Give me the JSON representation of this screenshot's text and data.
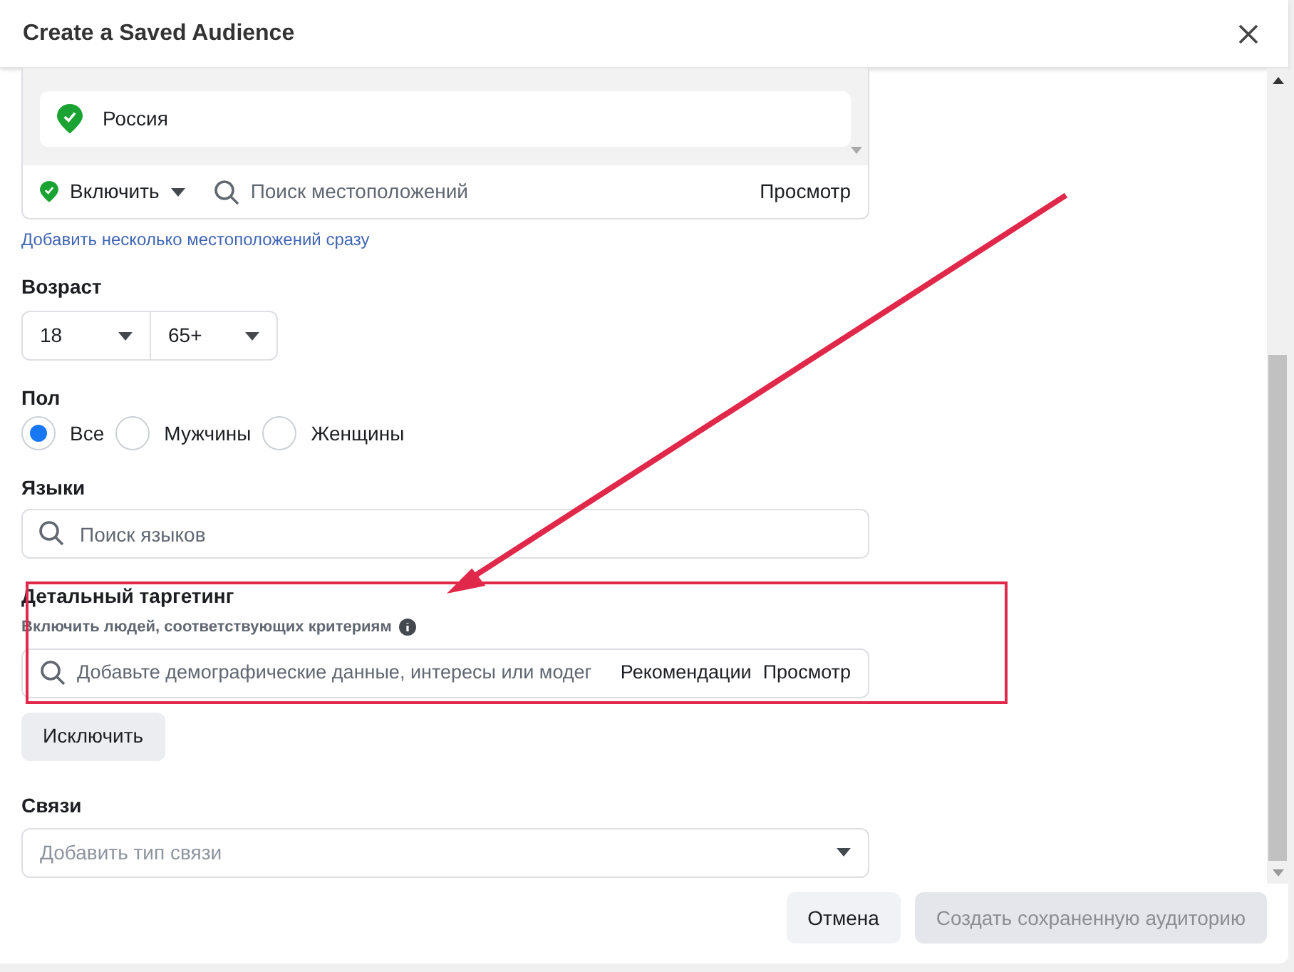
{
  "dialog": {
    "title": "Create a Saved Audience"
  },
  "locations": {
    "selected": [
      {
        "name": "Россия"
      }
    ],
    "mode": "Включить",
    "search_placeholder": "Поиск местоположений",
    "browse": "Просмотр",
    "bulk_link": "Добавить несколько местоположений сразу"
  },
  "age": {
    "label": "Возраст",
    "min": "18",
    "max": "65+"
  },
  "gender": {
    "label": "Пол",
    "options": [
      {
        "label": "Все",
        "selected": true
      },
      {
        "label": "Мужчины",
        "selected": false
      },
      {
        "label": "Женщины",
        "selected": false
      }
    ]
  },
  "languages": {
    "label": "Языки",
    "placeholder": "Поиск языков"
  },
  "detailed_targeting": {
    "label": "Детальный таргетинг",
    "subtitle": "Включить людей, соответствующих критериям",
    "placeholder": "Добавьте демографические данные, интересы или модег",
    "suggestions": "Рекомендации",
    "browse": "Просмотр",
    "exclude_button": "Исключить"
  },
  "connections": {
    "label": "Связи",
    "placeholder": "Добавить тип связи"
  },
  "footer": {
    "buttons": [
      {
        "label": "Отмена",
        "disabled": false
      },
      {
        "label": "Создать сохраненную аудиторию",
        "disabled": true
      }
    ]
  }
}
